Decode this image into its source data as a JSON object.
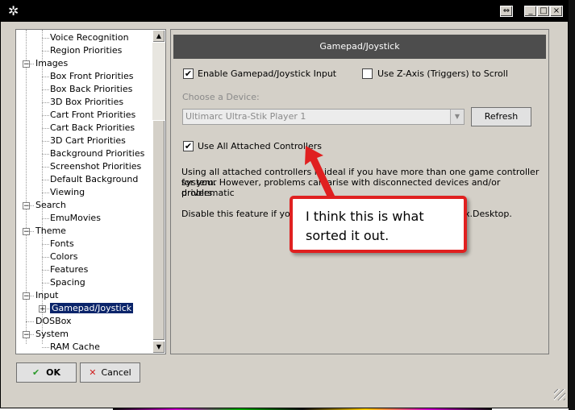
{
  "window": {
    "title_icon": "gear-icon",
    "controls": {
      "restore": "⇔",
      "minimize": "_",
      "maximize": "□",
      "close": "×"
    }
  },
  "tree": {
    "items": [
      {
        "label": "Voice Recognition",
        "level": 2
      },
      {
        "label": "Region Priorities",
        "level": 2
      },
      {
        "label": "Images",
        "level": 1,
        "expander": "−"
      },
      {
        "label": "Box Front Priorities",
        "level": 2
      },
      {
        "label": "Box Back Priorities",
        "level": 2
      },
      {
        "label": "3D Box Priorities",
        "level": 2
      },
      {
        "label": "Cart Front Priorities",
        "level": 2
      },
      {
        "label": "Cart Back Priorities",
        "level": 2
      },
      {
        "label": "3D Cart Priorities",
        "level": 2
      },
      {
        "label": "Background Priorities",
        "level": 2
      },
      {
        "label": "Screenshot Priorities",
        "level": 2
      },
      {
        "label": "Default Background",
        "level": 2
      },
      {
        "label": "Viewing",
        "level": 2
      },
      {
        "label": "Search",
        "level": 1,
        "expander": "−"
      },
      {
        "label": "EmuMovies",
        "level": 2
      },
      {
        "label": "Theme",
        "level": 1,
        "expander": "−"
      },
      {
        "label": "Fonts",
        "level": 2
      },
      {
        "label": "Colors",
        "level": 2
      },
      {
        "label": "Features",
        "level": 2
      },
      {
        "label": "Spacing",
        "level": 2
      },
      {
        "label": "Input",
        "level": 1,
        "expander": "−"
      },
      {
        "label": "Gamepad/Joystick",
        "level": 2,
        "expander": "+",
        "selected": true
      },
      {
        "label": "DOSBox",
        "level": 1
      },
      {
        "label": "System",
        "level": 1,
        "expander": "−"
      },
      {
        "label": "RAM Cache",
        "level": 2
      }
    ]
  },
  "panel": {
    "header": "Gamepad/Joystick",
    "enable_label": "Enable Gamepad/Joystick Input",
    "enable_checked": "✔",
    "zaxis_label": "Use Z-Axis (Triggers) to Scroll",
    "zaxis_checked": "",
    "device_label": "Choose a Device:",
    "device_value": "Ultimarc Ultra-Stik Player 1",
    "refresh_label": "Refresh",
    "use_all_label": "Use All Attached Controllers",
    "use_all_checked": "✔",
    "desc1_line1": "Using all attached controllers is ideal if you have more than one game controller for your",
    "desc1_line2": "system. However, problems can arise with disconnected devices and/or problematic",
    "desc1_line3": "drivers.",
    "desc2": "Disable this feature if you ex",
    "desc2_tail": "x.Desktop."
  },
  "callout": {
    "text": "I think this is what sorted it out.",
    "color": "#e02020"
  },
  "buttons": {
    "ok_label": "OK",
    "cancel_label": "Cancel",
    "ok_icon": "✔",
    "cancel_icon": "✕"
  }
}
